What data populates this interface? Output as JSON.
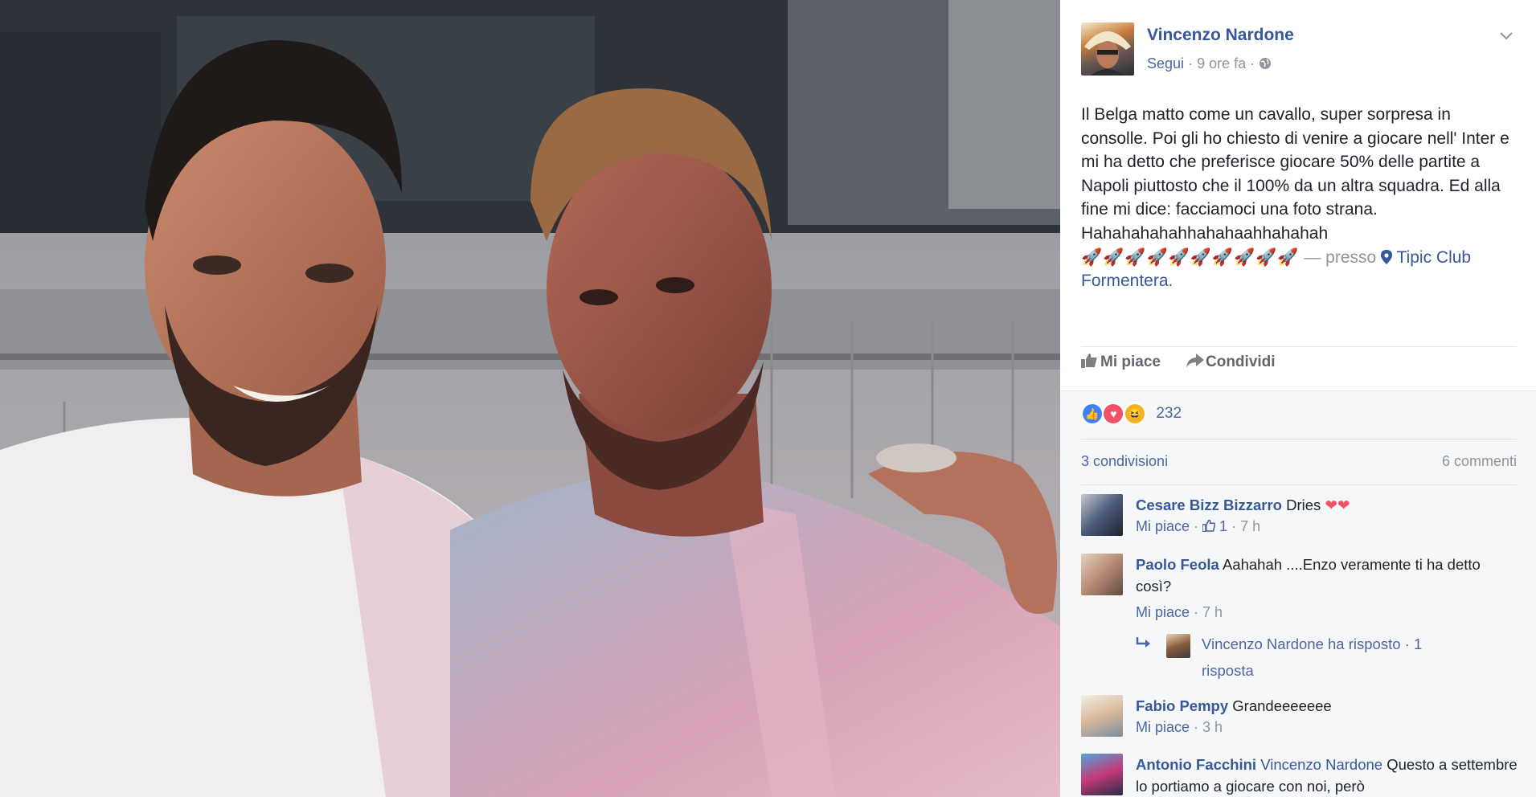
{
  "post": {
    "author": "Vincenzo Nardone",
    "follow": "Segui",
    "meta_sep": "·",
    "time": "9 ore fa",
    "privacy_icon": "globe-icon",
    "text_lines": [
      "Il Belga matto come un cavallo, super sorpresa in consolle. Poi gli ho chiesto di venire a giocare nell' Inter e mi ha detto che preferisce giocare 50% delle partite a Napoli piuttosto che il 100% da un altra squadra. Ed alla fine mi dice: facciamoci una foto strana.",
      "Hahahahahahhahahaahhahahah"
    ],
    "emojis": "🚀🚀🚀🚀🚀🚀🚀🚀🚀🚀",
    "location_sep": "— presso",
    "location_icon": "map-pin-icon",
    "location": "Tipic Club Formentera."
  },
  "actions": {
    "like_label": "Mi piace",
    "share_label": "Condividi",
    "like_icon": "thumbs-up-icon",
    "share_icon": "share-arrow-icon"
  },
  "reactions": {
    "types": [
      "like",
      "love",
      "haha"
    ],
    "count": "232"
  },
  "counts": {
    "shares": "3 condivisioni",
    "comments": "6 commenti"
  },
  "comments": [
    {
      "name": "Cesare Bizz Bizzarro",
      "text": "Dries",
      "hearts": "❤❤",
      "like": "Mi piace",
      "likes": "1",
      "time": "7 h"
    },
    {
      "name": "Paolo Feola",
      "text": "Aahahah ....Enzo veramente ti ha detto così?",
      "like": "Mi piace",
      "time": "7 h",
      "reply": "Vincenzo Nardone ha risposto · 1 risposta"
    },
    {
      "name": "Fabio Pempy",
      "text": "Grandeeeeeee",
      "like": "Mi piace",
      "time": "3 h"
    },
    {
      "name": "Antonio Facchini",
      "mention": "Vincenzo Nardone",
      "text": "Questo a settembre lo portiamo a giocare con noi, però"
    }
  ],
  "colors": {
    "link": "#365899",
    "meta": "#90949c",
    "text": "#1d2129",
    "panel_bg": "#ffffff",
    "comments_bg": "#f6f7f9"
  }
}
